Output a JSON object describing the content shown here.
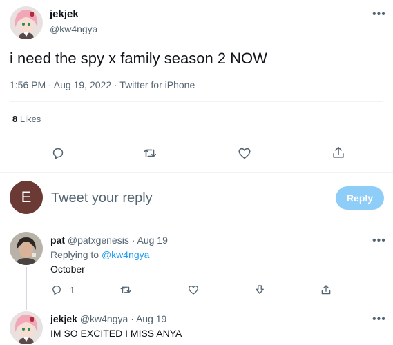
{
  "main_tweet": {
    "display_name": "jekjek",
    "handle": "@kw4ngya",
    "text": "i need the spy x family season 2 NOW",
    "meta": "1:56 PM · Aug 19, 2022 · Twitter for iPhone",
    "likes_count": "8",
    "likes_label": "Likes"
  },
  "composer": {
    "avatar_letter": "E",
    "placeholder": "Tweet your reply",
    "reply_button": "Reply"
  },
  "replies": [
    {
      "display_name": "pat",
      "handle": "@patxgenesis",
      "date": "· Aug 19",
      "replying_prefix": "Replying to",
      "replying_to": "@kw4ngya",
      "text": "October",
      "reply_count": "1"
    },
    {
      "display_name": "jekjek",
      "handle": "@kw4ngya",
      "date": "· Aug 19",
      "text": "IM SO EXCITED I MISS ANYA"
    }
  ],
  "more_glyph": "•••",
  "colors": {
    "accent": "#1d9bf0",
    "reply_button_disabled": "#8ecdf8",
    "secondary_text": "#536471",
    "composer_avatar": "#6b3a35",
    "divider": "#eff3f4"
  },
  "icons": [
    "reply-icon",
    "retweet-icon",
    "like-icon",
    "share-icon",
    "download-icon",
    "more-icon"
  ]
}
